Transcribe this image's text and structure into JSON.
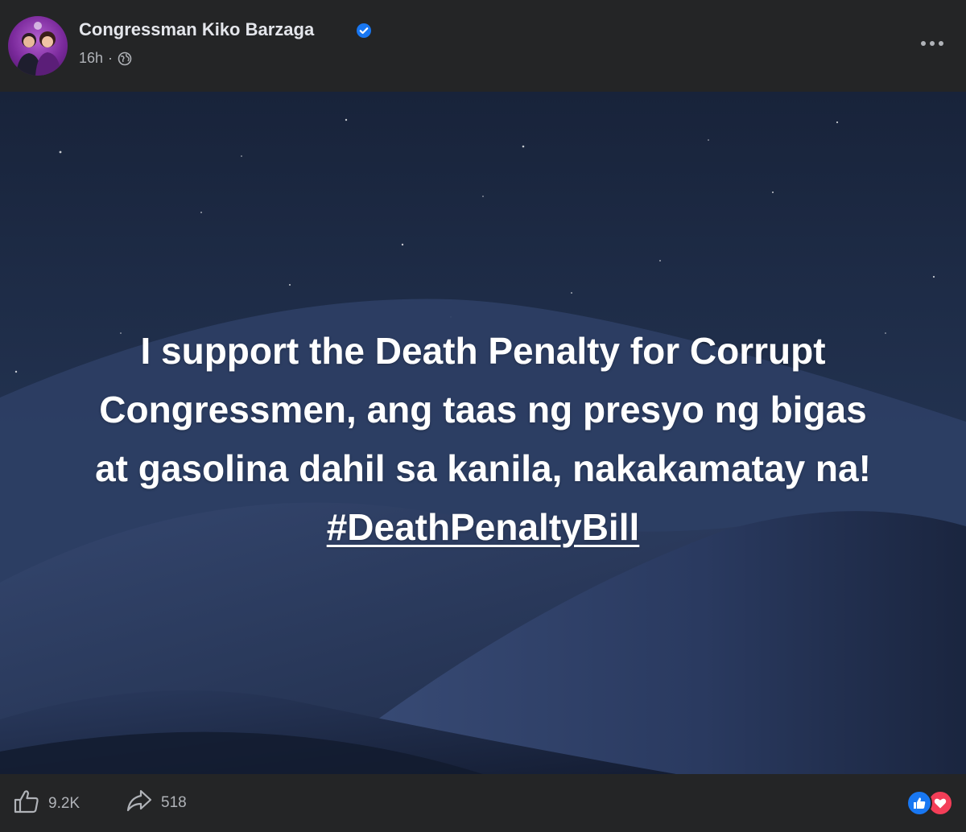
{
  "post": {
    "author": "Congressman Kiko Barzaga",
    "time": "16h",
    "separator": "·",
    "privacy_icon": "globe-icon",
    "verified_icon": "verified-badge-icon",
    "more_icon": "more-options-icon"
  },
  "image_text": {
    "line1": "I support the Death Penalty for Corrupt",
    "line2": "Congressmen, ang taas ng presyo ng bigas",
    "line3": "at gasolina dahil sa kanila, nakakamatay na!",
    "hashtag": "#DeathPenaltyBill"
  },
  "footer": {
    "like_count": "9.2K",
    "share_count": "518",
    "like_icon": "thumbs-up-icon",
    "share_icon": "share-arrow-icon",
    "reactions": [
      "like-reaction-icon",
      "love-reaction-icon"
    ]
  },
  "colors": {
    "background": "#242526",
    "primary_text": "#e4e6eb",
    "secondary_text": "#b0b3b8",
    "verified_blue": "#1877f2",
    "love_red": "#f33e58"
  }
}
